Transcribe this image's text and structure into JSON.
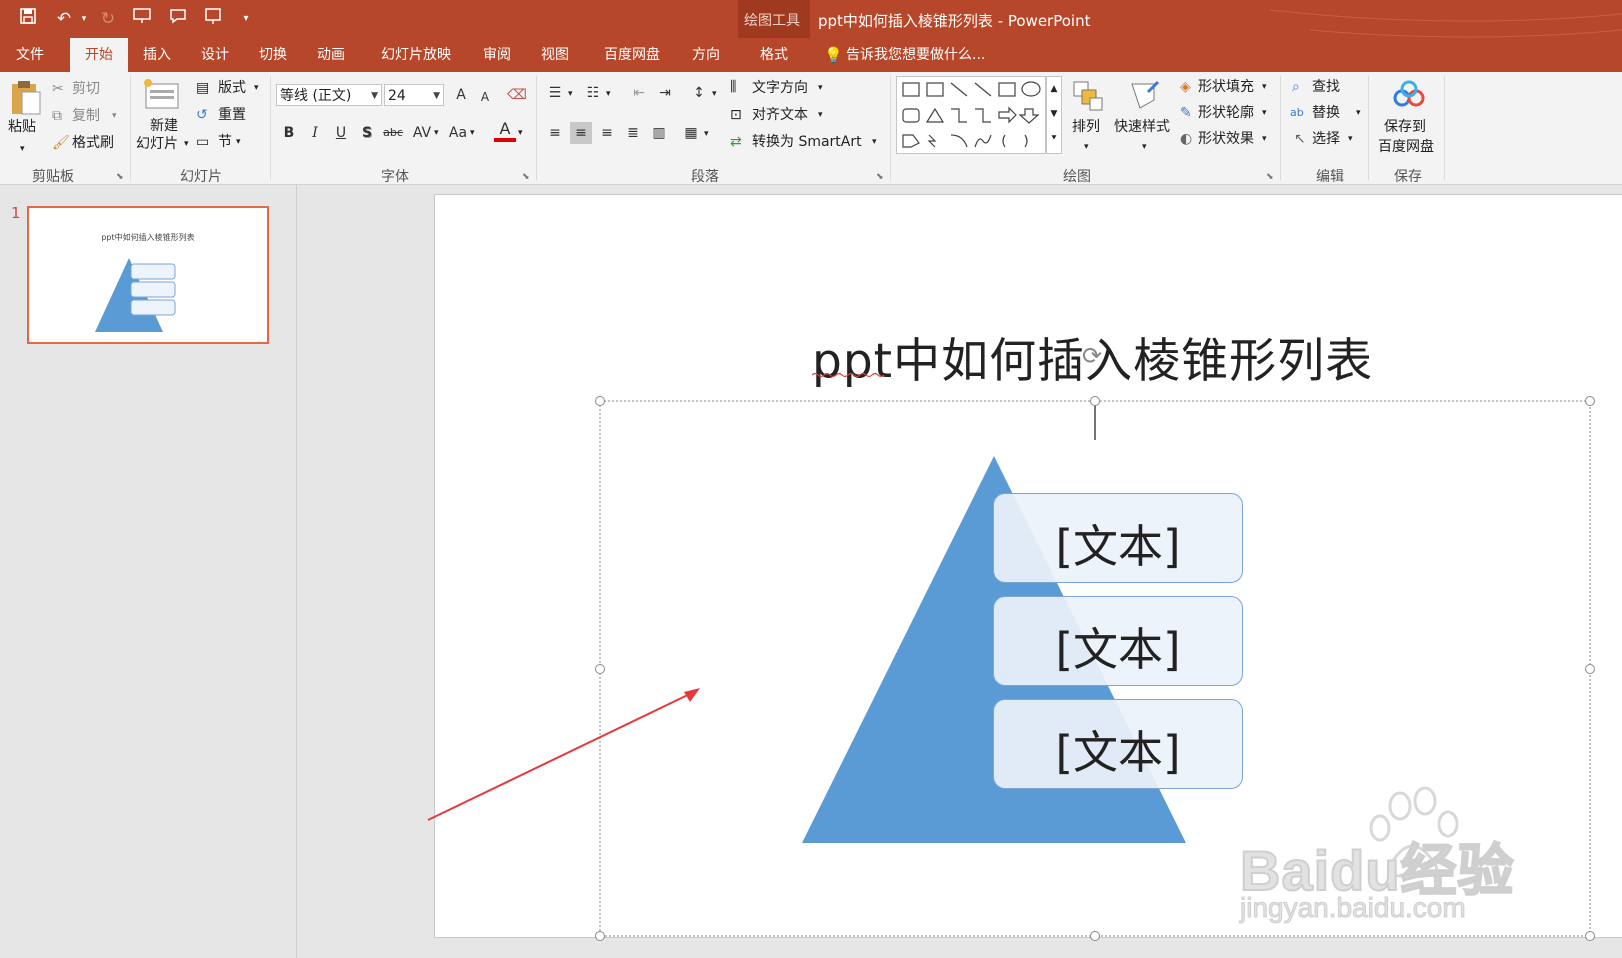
{
  "window": {
    "context_group": "绘图工具",
    "title": "ppt中如何插入棱锥形列表 - PowerPoint"
  },
  "tabs": [
    "文件",
    "开始",
    "插入",
    "设计",
    "切换",
    "动画",
    "幻灯片放映",
    "审阅",
    "视图",
    "百度网盘",
    "方向",
    "格式"
  ],
  "active_tab": "开始",
  "tell_me": "告诉我您想要做什么...",
  "ribbon": {
    "clipboard": {
      "paste": "粘贴",
      "cut": "剪切",
      "copy": "复制",
      "format_painter": "格式刷",
      "label": "剪贴板"
    },
    "slides": {
      "new_slide_1": "新建",
      "new_slide_2": "幻灯片",
      "layout": "版式",
      "reset": "重置",
      "section": "节",
      "label": "幻灯片"
    },
    "font": {
      "name": "等线 (正文)",
      "size": "24",
      "bold": "B",
      "italic": "I",
      "underline": "U",
      "shadow": "S",
      "strike": "abc",
      "spacing": "AV",
      "case": "Aa",
      "grow": "A",
      "shrink": "A",
      "color": "A",
      "label": "字体"
    },
    "paragraph": {
      "text_direction": "文字方向",
      "align_text": "对齐文本",
      "smartart": "转换为 SmartArt",
      "label": "段落"
    },
    "drawing": {
      "arrange": "排列",
      "quick_styles": "快速样式",
      "shape_fill": "形状填充",
      "shape_outline": "形状轮廓",
      "shape_effects": "形状效果",
      "label": "绘图"
    },
    "editing": {
      "find": "查找",
      "replace": "替换",
      "select": "选择",
      "label": "编辑"
    },
    "save": {
      "line1": "保存到",
      "line2": "百度网盘",
      "label": "保存"
    }
  },
  "thumbnail": {
    "number": "1",
    "title": "ppt中如何插入棱锥形列表"
  },
  "slide": {
    "title": "ppt中如何插入棱锥形列表",
    "items": [
      "[文本]",
      "[文本]",
      "[文本]"
    ]
  },
  "watermark": {
    "brand": "Baidu经验",
    "url": "jingyan.baidu.com"
  },
  "colors": {
    "accent": "#b7472a",
    "pyramid": "#5b9bd5",
    "arrow": "#e8393a"
  }
}
